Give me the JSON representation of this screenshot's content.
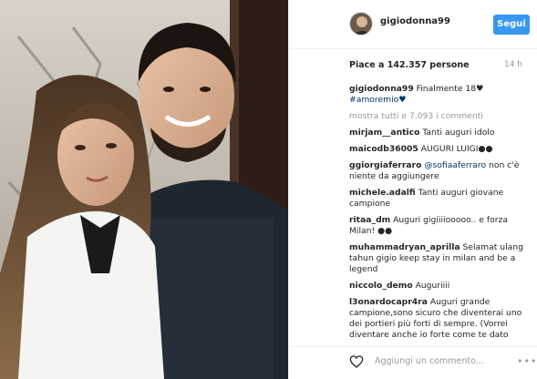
{
  "post": {
    "username": "gigiodonna99",
    "follow_label": "Segui",
    "likes": "Piace a 142.357 persone",
    "time": "14 h",
    "caption_user": "gigiodonna99",
    "caption_text": "Finalmente 18",
    "caption_emoji": "♥",
    "caption_hashtag": "#amoremio",
    "caption_hashtag_emoji": "♥",
    "show_all": "mostra tutti e 7.093 i commenti"
  },
  "comments": [
    {
      "user": "mirjam__antico",
      "text": "Tanti auguri idolo"
    },
    {
      "user": "maicodb36005",
      "text": "AUGURI LUIGI●●"
    },
    {
      "user": "ggiorgiaferraro",
      "mention": "@sofiaaferraro",
      "text": "non c'è niente da aggiungere"
    },
    {
      "user": "michele.adalfi",
      "text": "Tanti auguri giovane campione"
    },
    {
      "user": "ritaa_dm",
      "text": "Auguri gigiiiiooooo.. e forza Milan! ●●"
    },
    {
      "user": "muhammadryan_aprilla",
      "text": "Selamat ulang tahun gigio keep stay in milan and be a legend"
    },
    {
      "user": "niccolo_demo",
      "text": "Auguriiii"
    },
    {
      "user": "l3onardocapr4ra",
      "text": "Auguri grande campione,sono sicuro che diventerai uno dei portieri più forti di sempre. (Vorrei diventare anche io forte come te dato"
    }
  ],
  "footer": {
    "add_comment": "Aggiungi un commento...",
    "more": "•••"
  },
  "icons": {
    "like": "heart-icon",
    "more": "more-options-icon",
    "avatar": "avatar"
  }
}
